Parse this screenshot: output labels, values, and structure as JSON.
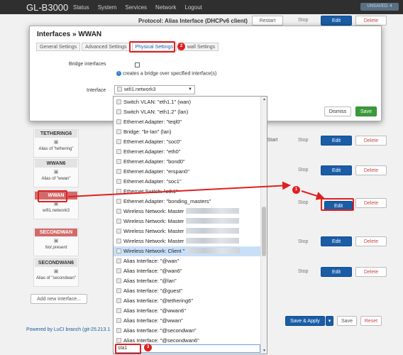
{
  "topbar": {
    "brand": "GL-B3000",
    "menu": [
      "Status",
      "System",
      "Services",
      "Network",
      "Logout"
    ],
    "unsaved": "UNSAVED: 4"
  },
  "background": {
    "protocol": "Protocol: Alias Interface (DHCPv6 client)",
    "buttons": {
      "restart": "Restart",
      "stop": "Stop",
      "edit": "Edit",
      "delete": "Delete",
      "start": "Start"
    },
    "interfaces": [
      {
        "name": "TETHERING6",
        "sub": "Alias of \"tethering\""
      },
      {
        "name": "WWAN6",
        "sub": "Alias of \"wwan\""
      },
      {
        "name": "WWAN",
        "sub": "wifi1.network3"
      },
      {
        "name": "SECONDWAN",
        "sub": "Not present"
      },
      {
        "name": "SECONDWAN6",
        "sub": "Alias of \"secondwan\""
      }
    ],
    "add_interface": "Add new interface...",
    "save_apply": "Save & Apply",
    "save": "Save",
    "reset": "Reset",
    "footer": "Powered by LuCI branch (git-25.213.1"
  },
  "modal": {
    "title": "Interfaces » WWAN",
    "tabs": [
      "General Settings",
      "Advanced Settings",
      "Physical Settings",
      "wall Settings"
    ],
    "active_tab": "Physical Settings",
    "bridge_label": "Bridge interfaces",
    "bridge_hint": "creates a bridge over specified interface(s)",
    "interface_label": "Interface",
    "interface_value": "wifi1.network3",
    "dismiss": "Dismiss",
    "save": "Save"
  },
  "dropdown": {
    "items": [
      "Switch VLAN: \"eth1.1\" (wan)",
      "Switch VLAN: \"eth1.2\" (lan)",
      "Ethernet Adapter: \"teql0\"",
      "Bridge: \"br-lan\" (lan)",
      "Ethernet Adapter: \"soc0\"",
      "Ethernet Adapter: \"eth0\"",
      "Ethernet Adapter: \"bond0\"",
      "Ethernet Adapter: \"erspan0\"",
      "Ethernet Adapter: \"soc1\"",
      "Ethernet Switch: \"eth1\"",
      "Ethernet Adapter: \"bonding_masters\"",
      "Wireless Network: Master",
      "Wireless Network: Master",
      "Wireless Network: Master",
      "Wireless Network: Master",
      "Wireless Network: Client \"",
      "Alias Interface: \"@wan\"",
      "Alias Interface: \"@wan6\"",
      "Alias Interface: \"@lan\"",
      "Alias Interface: \"@guest\"",
      "Alias Interface: \"@tethering6\"",
      "Alias Interface: \"@wwan6\"",
      "Alias Interface: \"@wwan\"",
      "Alias Interface: \"@secondwan\"",
      "Alias Interface: \"@secondwan6\""
    ],
    "selected_index": 15,
    "search_value": "sta1"
  },
  "annotations": {
    "badges": [
      "1",
      "2",
      "3"
    ],
    "color": "#e02020"
  },
  "colors": {
    "accent": "#1a5da6",
    "save_green": "#3c9a3c",
    "topbar": "#2f2f2f"
  }
}
